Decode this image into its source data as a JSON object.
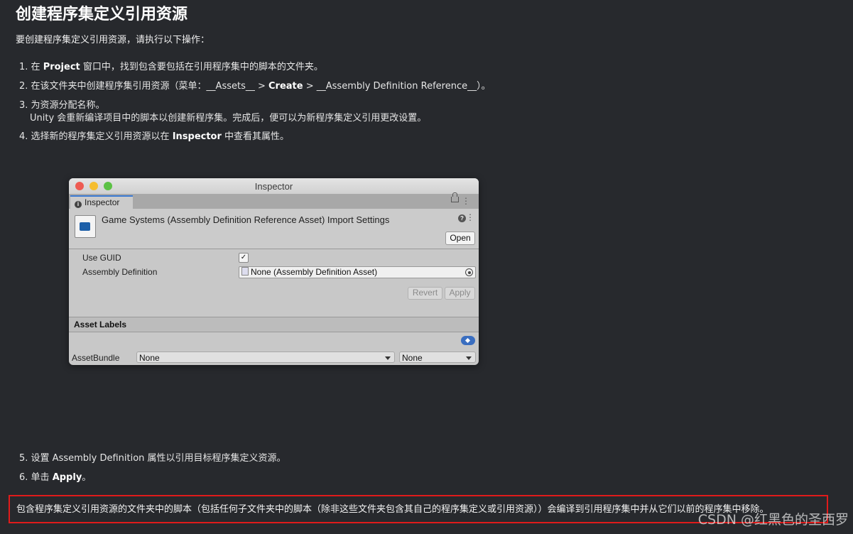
{
  "title": "创建程序集定义引用资源",
  "intro": "要创建程序集定义引用资源，请执行以下操作：",
  "steps": [
    {
      "num": "1.",
      "pre": "在 ",
      "bold": "Project",
      "post": " 窗口中，找到包含要包括在引用程序集中的脚本的文件夹。"
    },
    {
      "num": "2.",
      "pre": "在该文件夹中创建程序集引用资源（菜单：__Assets__ > ",
      "bold": "Create",
      "post": " > __Assembly Definition Reference__）。"
    },
    {
      "num": "3.",
      "text": "为资源分配名称。",
      "sub": "Unity 会重新编译项目中的脚本以创建新程序集。完成后，便可以为新程序集定义引用更改设置。"
    },
    {
      "num": "4.",
      "pre": "选择新的程序集定义引用资源以在 ",
      "bold": "Inspector",
      "post": " 中查看其属性。"
    }
  ],
  "inspector": {
    "window_title": "Inspector",
    "tab_label": "Inspector",
    "asset_title": "Game Systems (Assembly Definition Reference Asset) Import Settings",
    "open_label": "Open",
    "use_guid_label": "Use GUID",
    "use_guid_checked": true,
    "check_mark": "✓",
    "assembly_definition_label": "Assembly Definition",
    "assembly_definition_value": "None (Assembly Definition Asset)",
    "revert_label": "Revert",
    "apply_label": "Apply",
    "asset_labels_header": "Asset Labels",
    "asset_bundle_label": "AssetBundle",
    "asset_bundle_value": "None",
    "asset_bundle_variant": "None",
    "colors": {
      "tab_accent": "#3a79d1",
      "close": "#ee5b52",
      "minimize": "#f5bd2f",
      "maximize": "#5bc144"
    }
  },
  "steps_after": [
    {
      "num": "5.",
      "text": "设置 Assembly Definition 属性以引用目标程序集定义资源。"
    },
    {
      "num": "6.",
      "pre": "单击 ",
      "bold": "Apply",
      "post": "。"
    }
  ],
  "note": "包含程序集定义引用资源的文件夹中的脚本（包括任何子文件夹中的脚本（除非这些文件夹包含其自己的程序集定义或引用资源））会编译到引用程序集中并从它们以前的程序集中移除。",
  "watermark": "CSDN @红黑色的圣西罗",
  "colors": {
    "background": "#27292d",
    "highlight_border": "#e01b1b"
  }
}
